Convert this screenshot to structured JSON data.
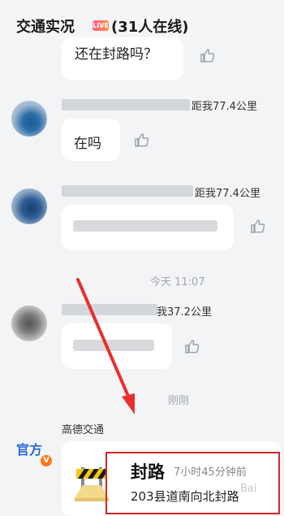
{
  "header": {
    "title": "交通实况",
    "live_badge": "LIVE",
    "online_count": "(31人在线)"
  },
  "messages": [
    {
      "text": "还在封路吗？"
    },
    {
      "distance": "距我77.4公里",
      "text": "在吗"
    },
    {
      "distance": "距我77.4公里"
    },
    {
      "distance": "我37.2公里"
    }
  ],
  "timestamps": {
    "first": "今天 11:07",
    "second": "刚刚"
  },
  "official": {
    "badge_label": "官方",
    "badge_v": "V",
    "sender": "高德交通",
    "card_title": "封路",
    "card_time": "7小时45分钟前",
    "card_desc": "203县道南向北封路"
  },
  "watermark": "Bai",
  "colors": {
    "highlight_border": "#d6262b",
    "official_blue": "#2a6bd8",
    "arrow_red": "#e8302f"
  }
}
